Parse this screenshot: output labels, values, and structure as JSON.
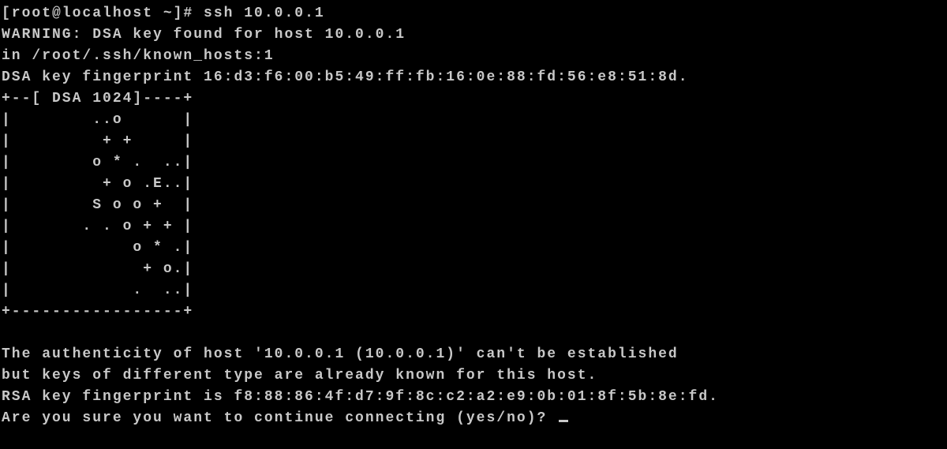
{
  "terminal": {
    "prompt": "[root@localhost ~]# ",
    "command": "ssh 10.0.0.1",
    "warning": "WARNING: DSA key found for host 10.0.0.1",
    "known_hosts": "in /root/.ssh/known_hosts:1",
    "dsa_fp": "DSA key fingerprint 16:d3:f6:00:b5:49:ff:fb:16:0e:88:fd:56:e8:51:8d.",
    "art": {
      "top": "+--[ DSA 1024]----+",
      "r1": "|        ..o      |",
      "r2": "|         + +     |",
      "r3": "|        o * .  ..|",
      "r4": "|         + o .E..|",
      "r5": "|        S o o +  |",
      "r6": "|       . . o + + |",
      "r7": "|            o * .|",
      "r8": "|             + o.|",
      "r9": "|            .  ..|",
      "bot": "+-----------------+"
    },
    "blank": "",
    "auth1": "The authenticity of host '10.0.0.1 (10.0.0.1)' can't be established",
    "auth2": "but keys of different type are already known for this host.",
    "rsa_fp": "RSA key fingerprint is f8:88:86:4f:d7:9f:8c:c2:a2:e9:0b:01:8f:5b:8e:fd.",
    "confirm": "Are you sure you want to continue connecting (yes/no)? "
  }
}
